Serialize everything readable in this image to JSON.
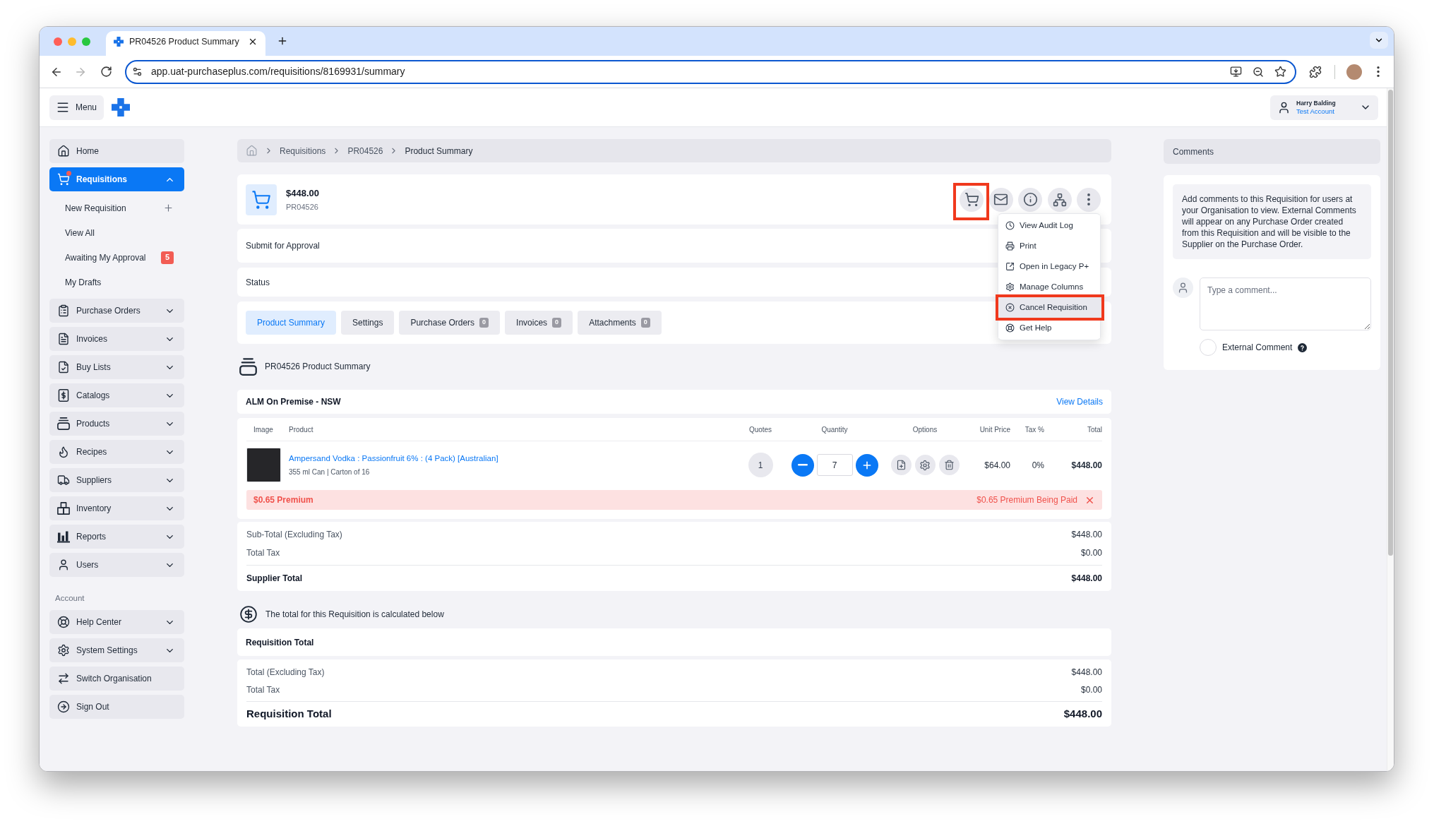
{
  "browser": {
    "tab_title": "PR04526 Product Summary",
    "url": "app.uat-purchaseplus.com/requisitions/8169931/summary",
    "forward_disabled": true
  },
  "header": {
    "menu_label": "Menu",
    "user_name": "Harry Balding",
    "account": "Test Account"
  },
  "sidebar": {
    "items": [
      {
        "label": "Home",
        "selected": false
      },
      {
        "label": "Requisitions",
        "selected": true,
        "expanded": true,
        "alert": true,
        "children": [
          {
            "label": "New Requisition",
            "kind": "create",
            "selected": false
          },
          {
            "label": "View All",
            "kind": "link",
            "selected": false
          },
          {
            "label": "Awaiting My Approval",
            "kind": "link",
            "selected": false,
            "badge": "5"
          },
          {
            "label": "My Drafts",
            "kind": "link",
            "selected": false
          }
        ]
      },
      {
        "label": "Purchase Orders",
        "selected": false,
        "expanded": false
      },
      {
        "label": "Invoices",
        "selected": false,
        "expanded": false
      },
      {
        "label": "Buy Lists",
        "selected": false,
        "expanded": false
      },
      {
        "label": "Catalogs",
        "selected": false,
        "expanded": false
      },
      {
        "label": "Products",
        "selected": false,
        "expanded": false
      },
      {
        "label": "Recipes",
        "selected": false,
        "expanded": false
      },
      {
        "label": "Suppliers",
        "selected": false,
        "expanded": false
      },
      {
        "label": "Inventory",
        "selected": false,
        "expanded": false
      },
      {
        "label": "Reports",
        "selected": false,
        "expanded": false
      },
      {
        "label": "Users",
        "selected": false,
        "expanded": false
      }
    ],
    "section_label": "Account",
    "account_items": [
      {
        "label": "Help Center",
        "selected": false,
        "expanded": false
      },
      {
        "label": "System Settings",
        "selected": false,
        "expanded": false
      },
      {
        "label": "Switch Organisation",
        "selected": false
      },
      {
        "label": "Sign Out",
        "selected": false
      }
    ]
  },
  "breadcrumb": [
    "Requisitions",
    "PR04526",
    "Product Summary"
  ],
  "requisition": {
    "amount": "$448.00",
    "number": "PR04526",
    "actions": [
      {
        "highlighted": true
      },
      {
        "highlighted": false
      },
      {
        "highlighted": false
      },
      {
        "highlighted": false
      },
      {
        "highlighted": false
      }
    ],
    "menu": [
      {
        "label": "View Audit Log",
        "hovered": false,
        "highlighted": false
      },
      {
        "label": "Print",
        "hovered": false,
        "highlighted": false
      },
      {
        "label": "Open in Legacy P+",
        "hovered": false,
        "highlighted": false
      },
      {
        "label": "Manage Columns",
        "hovered": false,
        "highlighted": false
      },
      {
        "label": "Cancel Requisition",
        "hovered": true,
        "highlighted": true
      },
      {
        "label": "Get Help",
        "hovered": false,
        "highlighted": false
      }
    ]
  },
  "panels": [
    "Submit for Approval",
    "Status"
  ],
  "tabs": [
    {
      "label": "Product Summary",
      "selected": true
    },
    {
      "label": "Settings",
      "selected": false
    },
    {
      "label": "Purchase Orders",
      "count": "0",
      "selected": false
    },
    {
      "label": "Invoices",
      "count": "0",
      "selected": false
    },
    {
      "label": "Attachments",
      "count": "0",
      "selected": false
    }
  ],
  "summary_title": "PR04526 Product Summary",
  "supplier": {
    "name": "ALM On Premise - NSW",
    "link": "View Details",
    "columns": [
      "Image",
      "Product",
      "Quotes",
      "Quantity",
      "Options",
      "Unit Price",
      "Tax %",
      "Total"
    ],
    "rows": [
      {
        "product": "Ampersand Vodka : Passionfruit 6% : (4 Pack) [Australian]",
        "details": "355 ml Can | Carton of 16",
        "quotes": "1",
        "quantity": "7",
        "unit_price": "$64.00",
        "tax": "0%",
        "total": "$448.00",
        "premium": "$0.65 Premium",
        "premium_status": "$0.65 Premium Being Paid"
      }
    ],
    "totals": [
      {
        "label": "Sub-Total (Excluding Tax)",
        "value": "$448.00"
      },
      {
        "label": "Total Tax",
        "value": "$0.00"
      }
    ],
    "total": {
      "label": "Supplier Total",
      "value": "$448.00"
    }
  },
  "requisition_note": "The total for this Requisition is calculated below",
  "requisition_total": {
    "title": "Requisition Total",
    "rows": [
      {
        "label": "Total (Excluding Tax)",
        "value": "$448.00"
      },
      {
        "label": "Total Tax",
        "value": "$0.00"
      }
    ],
    "total": {
      "label": "Requisition Total",
      "value": "$448.00"
    }
  },
  "comments": {
    "title": "Comments",
    "info": "Add comments to this Requisition for users at your Organisation to view. External Comments will appear on any Purchase Order created from this Requisition and will be visible to the Supplier on the Purchase Order.",
    "placeholder": "Type a comment...",
    "external": {
      "label": "External Comment",
      "on": false
    }
  }
}
